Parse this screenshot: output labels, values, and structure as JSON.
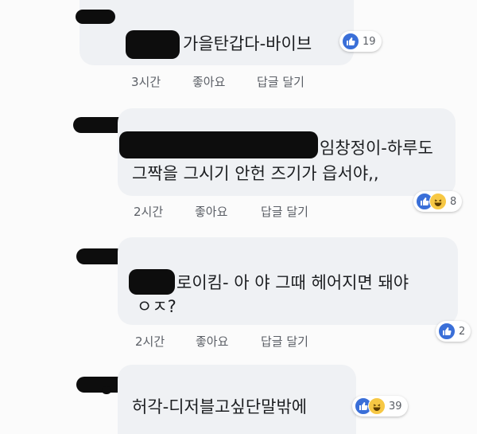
{
  "comments": [
    {
      "text_lines": [
        "가을탄갑다-바이브"
      ],
      "time": "3시간",
      "like_label": "좋아요",
      "reply_label": "답글 달기",
      "reaction_icons": [
        "like-icon"
      ],
      "reaction_count": "19"
    },
    {
      "text_lines": [
        "임창정이-하루도",
        "그짝을 그시기 안헌 즈기가 읍서야,,"
      ],
      "time": "2시간",
      "like_label": "좋아요",
      "reply_label": "답글 달기",
      "reaction_icons": [
        "like-icon",
        "haha-icon"
      ],
      "reaction_count": "8"
    },
    {
      "text_lines": [
        "로이킴- 아 야 그때 헤어지면 돼야",
        "ㅇㅈ?"
      ],
      "time": "2시간",
      "like_label": "좋아요",
      "reply_label": "답글 달기",
      "reaction_icons": [
        "like-icon"
      ],
      "reaction_count": "2"
    },
    {
      "text_lines": [
        "허각-디저블고싶단말밖에"
      ],
      "reaction_icons": [
        "like-icon",
        "haha-icon"
      ],
      "reaction_count": "39"
    }
  ],
  "colors": {
    "bubble": "#eff1f4",
    "like_blue": "#3a6fd8",
    "haha_yellow": "#f7c844",
    "meta_text": "#5b5f66"
  }
}
